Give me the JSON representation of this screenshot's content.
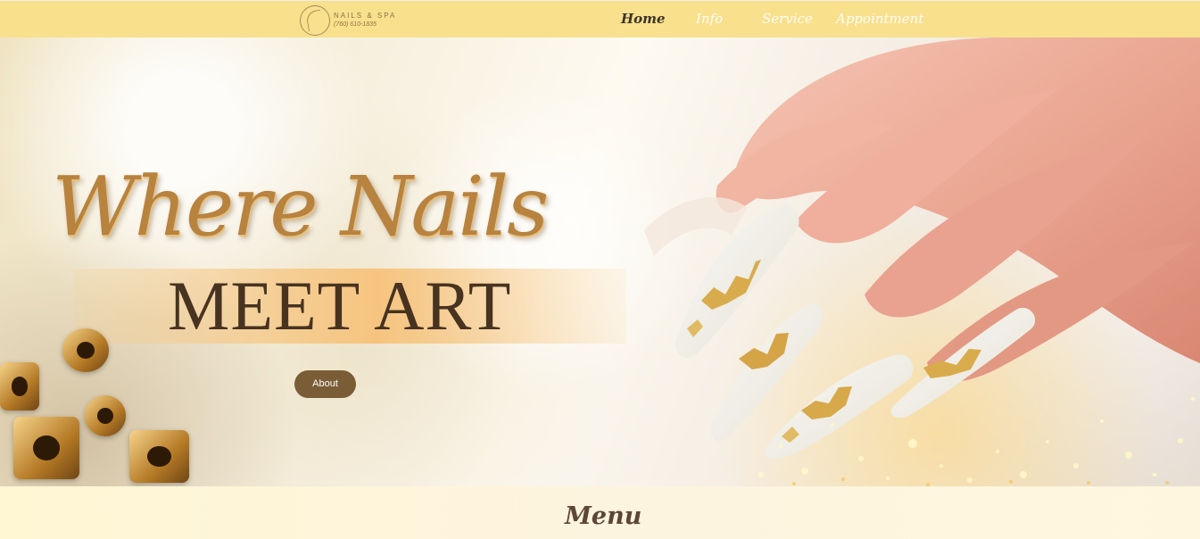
{
  "brand": {
    "name": "NAILS & SPA",
    "phone": "(760) 610-1835"
  },
  "nav": {
    "items": [
      {
        "label": "Home",
        "active": true
      },
      {
        "label": "Info",
        "active": false
      },
      {
        "label": "Service",
        "active": false
      },
      {
        "label": "Appointment",
        "active": false
      }
    ]
  },
  "hero": {
    "headline_script": "Where Nails",
    "headline_caps": "MEET ART",
    "button_label": "About"
  },
  "section": {
    "title": "Menu"
  },
  "colors": {
    "topbar": "#f8e08d",
    "nav_active": "#3d3328",
    "nav_inactive": "#fffdf6",
    "accent_gold": "#b8823f",
    "button": "#7a5d36"
  },
  "icons": {
    "logo": "nail-spa-logo-icon"
  }
}
